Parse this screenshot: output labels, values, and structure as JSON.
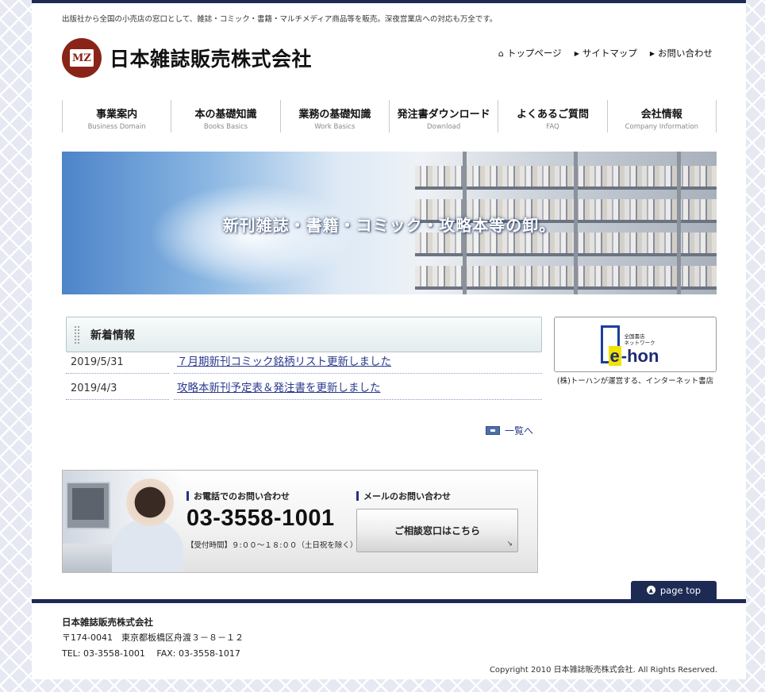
{
  "tagline": "出版社から全国の小売店の窓口として、雑誌・コミック・書籍・マルチメディア商品等を販売。深夜営業店への対応も万全です。",
  "logo": {
    "mark": "MZ",
    "name": "日本雑誌販売株式会社"
  },
  "utility_nav": [
    {
      "label": "トップページ",
      "icon": "home-icon"
    },
    {
      "label": "サイトマップ",
      "icon": "triangle-right-icon"
    },
    {
      "label": "お問い合わせ",
      "icon": "triangle-right-icon"
    }
  ],
  "global_nav": [
    {
      "jp": "事業案内",
      "en": "Business Domain"
    },
    {
      "jp": "本の基礎知識",
      "en": "Books Basics"
    },
    {
      "jp": "業務の基礎知識",
      "en": "Work Basics"
    },
    {
      "jp": "発注書ダウンロード",
      "en": "Download"
    },
    {
      "jp": "よくあるご質問",
      "en": "FAQ"
    },
    {
      "jp": "会社情報",
      "en": "Company Information"
    }
  ],
  "hero": {
    "caption": "新刊雑誌・書籍・コミック・攻略本等の卸。"
  },
  "news": {
    "title": "新着情報",
    "items": [
      {
        "date": "2019/5/31",
        "text": "７月期新刊コミック銘柄リスト更新しました"
      },
      {
        "date": "2019/4/3",
        "text": "攻略本新刊予定表＆発注書を更新しました"
      }
    ],
    "more_label": "一覧へ"
  },
  "ehon": {
    "small_line1": "全国書店",
    "small_line2": "ネットワーク",
    "logo_e": "e",
    "logo_rest": "-hon",
    "caption": "(株)トーハンが運営する、インターネット書店"
  },
  "contact": {
    "phone_title": "お電話でのお問い合わせ",
    "phone": "03-3558-1001",
    "hours": "【受付時間】９:００～１８:００（土日祝を除く）",
    "mail_title": "メールのお問い合わせ",
    "mail_button": "ご相談窓口はこちら"
  },
  "pagetop": {
    "label": "page top"
  },
  "footer": {
    "company": "日本雑誌販売株式会社",
    "address": "〒174-0041　東京都板橋区舟渡３－８－１２",
    "tel_fax": "TEL: 03-3558-1001　 FAX: 03-3558-1017",
    "copyright": "Copyright 2010 日本雑誌販売株式会社. All Rights Reserved."
  }
}
